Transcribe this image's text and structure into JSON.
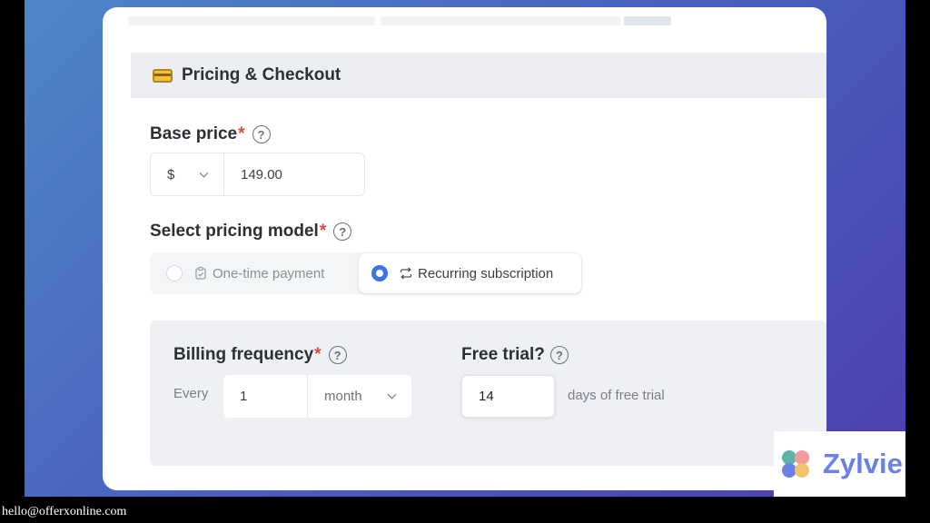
{
  "section": {
    "title": "Pricing & Checkout",
    "icon": "credit-card-icon"
  },
  "base_price": {
    "label": "Base price",
    "required_mark": "*",
    "help": "?",
    "currency": "$",
    "value": "149.00"
  },
  "pricing_model": {
    "label": "Select pricing model",
    "required_mark": "*",
    "help": "?",
    "options": [
      {
        "label": "One-time payment",
        "selected": false,
        "icon": "clipboard-check-icon"
      },
      {
        "label": "Recurring subscription",
        "selected": true,
        "icon": "repeat-icon"
      }
    ]
  },
  "billing": {
    "label": "Billing frequency",
    "required_mark": "*",
    "help": "?",
    "prefix": "Every",
    "interval": "1",
    "unit": "month"
  },
  "free_trial": {
    "label": "Free trial?",
    "help": "?",
    "value": "14",
    "suffix": "days of free trial"
  },
  "brand": {
    "name": "Zylvie",
    "color": "#6a82e6"
  },
  "footer": {
    "email": "hello@offerxonline.com"
  },
  "colors": {
    "accent": "#3b73e6",
    "required": "#e0463f"
  }
}
